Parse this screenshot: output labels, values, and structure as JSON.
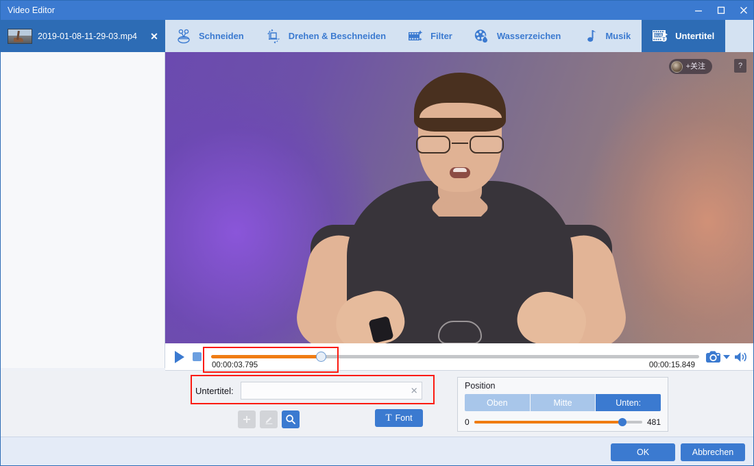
{
  "window": {
    "title": "Video Editor",
    "minimize_icon": "minimize-icon",
    "maximize_icon": "maximize-icon",
    "close_icon": "close-icon"
  },
  "file_tab": {
    "name": "2019-01-08-11-29-03.mp4",
    "close_label": "✕"
  },
  "toolbar": {
    "tabs": [
      {
        "label": "Schneiden",
        "icon": "scissors-icon",
        "active": false
      },
      {
        "label": "Drehen & Beschneiden",
        "icon": "rotate-crop-icon",
        "active": false
      },
      {
        "label": "Filter",
        "icon": "filmstrip-sparkle-icon",
        "active": false
      },
      {
        "label": "Wasserzeichen",
        "icon": "watermark-droplet-icon",
        "active": false
      },
      {
        "label": "Musik",
        "icon": "music-note-icon",
        "active": false
      },
      {
        "label": "Untertitel",
        "icon": "subtitle-icon",
        "active": true
      }
    ]
  },
  "preview": {
    "overlay_follow_text": "+关注",
    "overlay_help_text": "?"
  },
  "player": {
    "play_icon": "play-icon",
    "stop_icon": "stop-icon",
    "current_time": "00:00:03.795",
    "total_time": "00:00:15.849",
    "progress_percent": 22.5,
    "snapshot_icon": "camera-icon",
    "snapshot_dropdown_icon": "chevron-down-icon",
    "volume_icon": "speaker-icon"
  },
  "subtitle": {
    "label": "Untertitel:",
    "value": "",
    "placeholder": "",
    "clear_icon": "clear-x-icon",
    "add_icon": "plus-icon",
    "edit_icon": "pencil-icon",
    "search_icon": "search-icon",
    "font_button": "Font",
    "font_glyph": "T"
  },
  "position": {
    "title": "Position",
    "options": [
      {
        "label": "Oben",
        "active": false
      },
      {
        "label": "Mitte",
        "active": false
      },
      {
        "label": "Unten:",
        "active": true
      }
    ],
    "min": "0",
    "max": "481",
    "value_percent": 88
  },
  "footer": {
    "ok_label": "OK",
    "cancel_label": "Abbrechen"
  },
  "colors": {
    "title_blue": "#3b7ad0",
    "toolbar_blue": "#2d6cb5",
    "tab_strip": "#d4e2f2",
    "accent_orange": "#f07c12",
    "highlight_red": "#fb1a10",
    "panel_bg": "#eff1f5",
    "footer_bg": "#e4ebf7"
  }
}
